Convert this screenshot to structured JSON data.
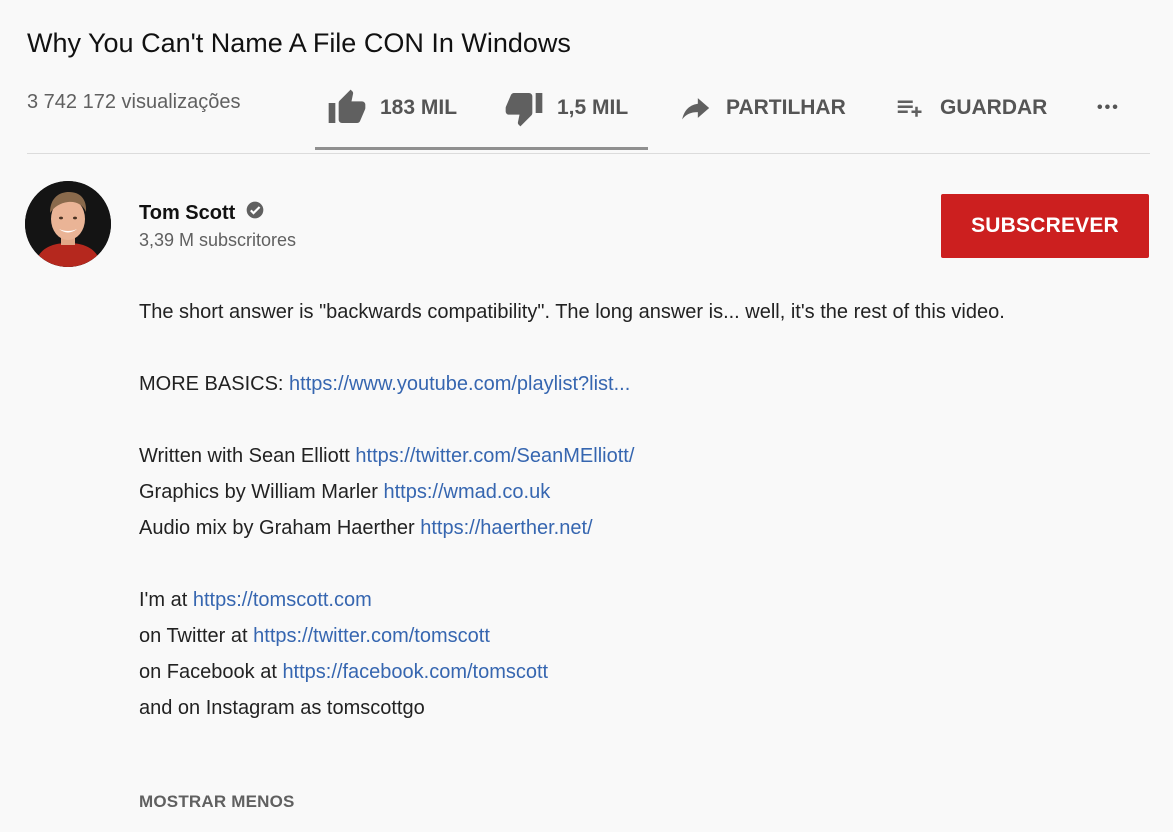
{
  "video": {
    "title": "Why You Can't Name A File CON In Windows",
    "views": "3 742 172 visualizações"
  },
  "actions": {
    "like_count": "183 MIL",
    "dislike_count": "1,5 MIL",
    "share_label": "PARTILHAR",
    "save_label": "GUARDAR",
    "more_label": "•••",
    "like_ratio": 0.992
  },
  "channel": {
    "name": "Tom Scott",
    "subscribers": "3,39 M subscritores",
    "subscribe_label": "SUBSCREVER",
    "verified": true
  },
  "description": {
    "line1": "The short answer is \"backwards compatibility\". The long answer is... well, it's the rest of this video.",
    "more_basics_label": "MORE BASICS: ",
    "more_basics_link": "https://www.youtube.com/playlist?list...",
    "written_label": "Written with Sean Elliott ",
    "written_link": "https://twitter.com/SeanMElliott/",
    "graphics_label": "Graphics by William Marler ",
    "graphics_link": "https://wmad.co.uk",
    "audio_label": "Audio mix by Graham Haerther ",
    "audio_link": "https://haerther.net/",
    "im_at_label": "I'm at ",
    "im_at_link": "https://tomscott.com",
    "twitter_label": "on Twitter at ",
    "twitter_link": "https://twitter.com/tomscott",
    "facebook_label": "on Facebook at ",
    "facebook_link": "https://facebook.com/tomscott",
    "instagram_line": "and on Instagram as tomscottgo"
  },
  "show_less_label": "MOSTRAR MENOS",
  "colors": {
    "subscribe_bg": "#cc1f1f",
    "link": "#3666b0",
    "secondary_text": "#606060"
  }
}
